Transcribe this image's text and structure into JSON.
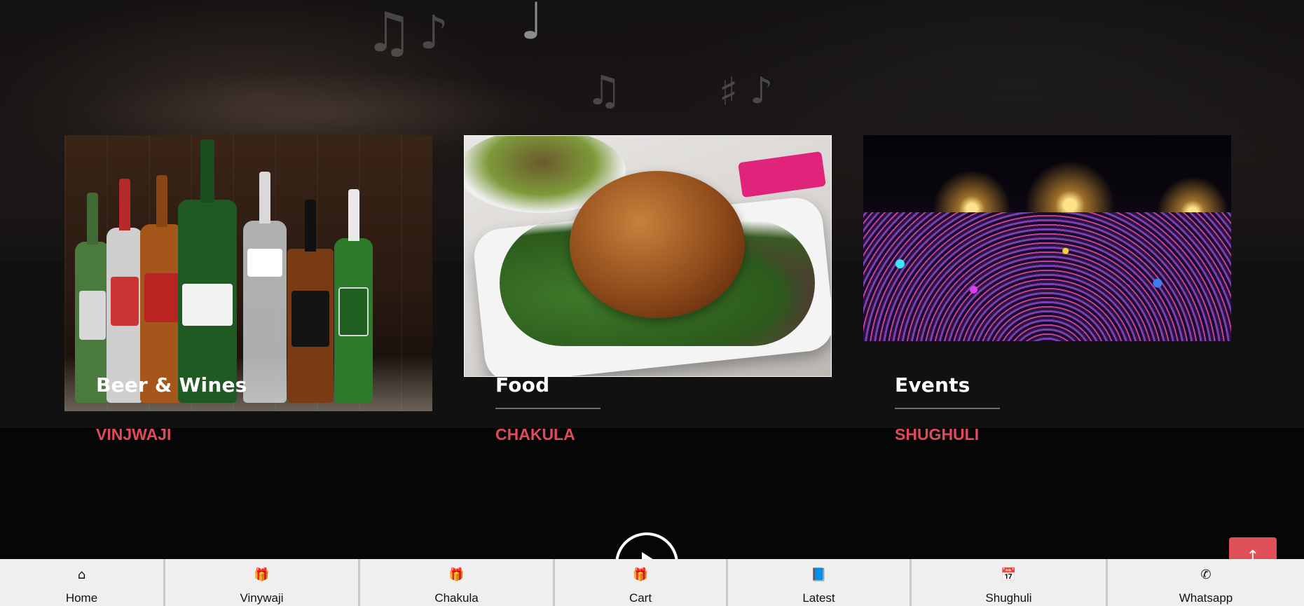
{
  "hero": {
    "music_notes": [
      "♫",
      "♪",
      "♩",
      "♫",
      "♯",
      "♪"
    ]
  },
  "cards": [
    {
      "title": "Beer & Wines",
      "subtitle": "VINJWAJI",
      "image": "beer-wines-image"
    },
    {
      "title": "Food",
      "subtitle": "CHAKULA",
      "image": "food-image"
    },
    {
      "title": "Events",
      "subtitle": "SHUGHULI",
      "image": "events-image"
    }
  ],
  "play_button": {
    "icon": "play-icon"
  },
  "back_to_top": {
    "icon": "arrow-up-icon",
    "glyph": "↑"
  },
  "bottom_nav": {
    "items": [
      {
        "label": "Home",
        "icon": "home-icon",
        "glyph": "⌂"
      },
      {
        "label": "Vinywaji",
        "icon": "gift-icon",
        "glyph": "🎁"
      },
      {
        "label": "Chakula",
        "icon": "gift-icon",
        "glyph": "🎁"
      },
      {
        "label": "Cart",
        "icon": "gift-icon",
        "glyph": "🎁"
      },
      {
        "label": "Latest",
        "icon": "book-icon",
        "glyph": "📘"
      },
      {
        "label": "Shughuli",
        "icon": "calendar-icon",
        "glyph": "📅"
      },
      {
        "label": "Whatsapp",
        "icon": "whatsapp-icon",
        "glyph": "✆"
      }
    ]
  },
  "colors": {
    "accent": "#e04a5a",
    "button_red": "#e05058",
    "nav_bg": "#efefef",
    "band": "#111111"
  }
}
